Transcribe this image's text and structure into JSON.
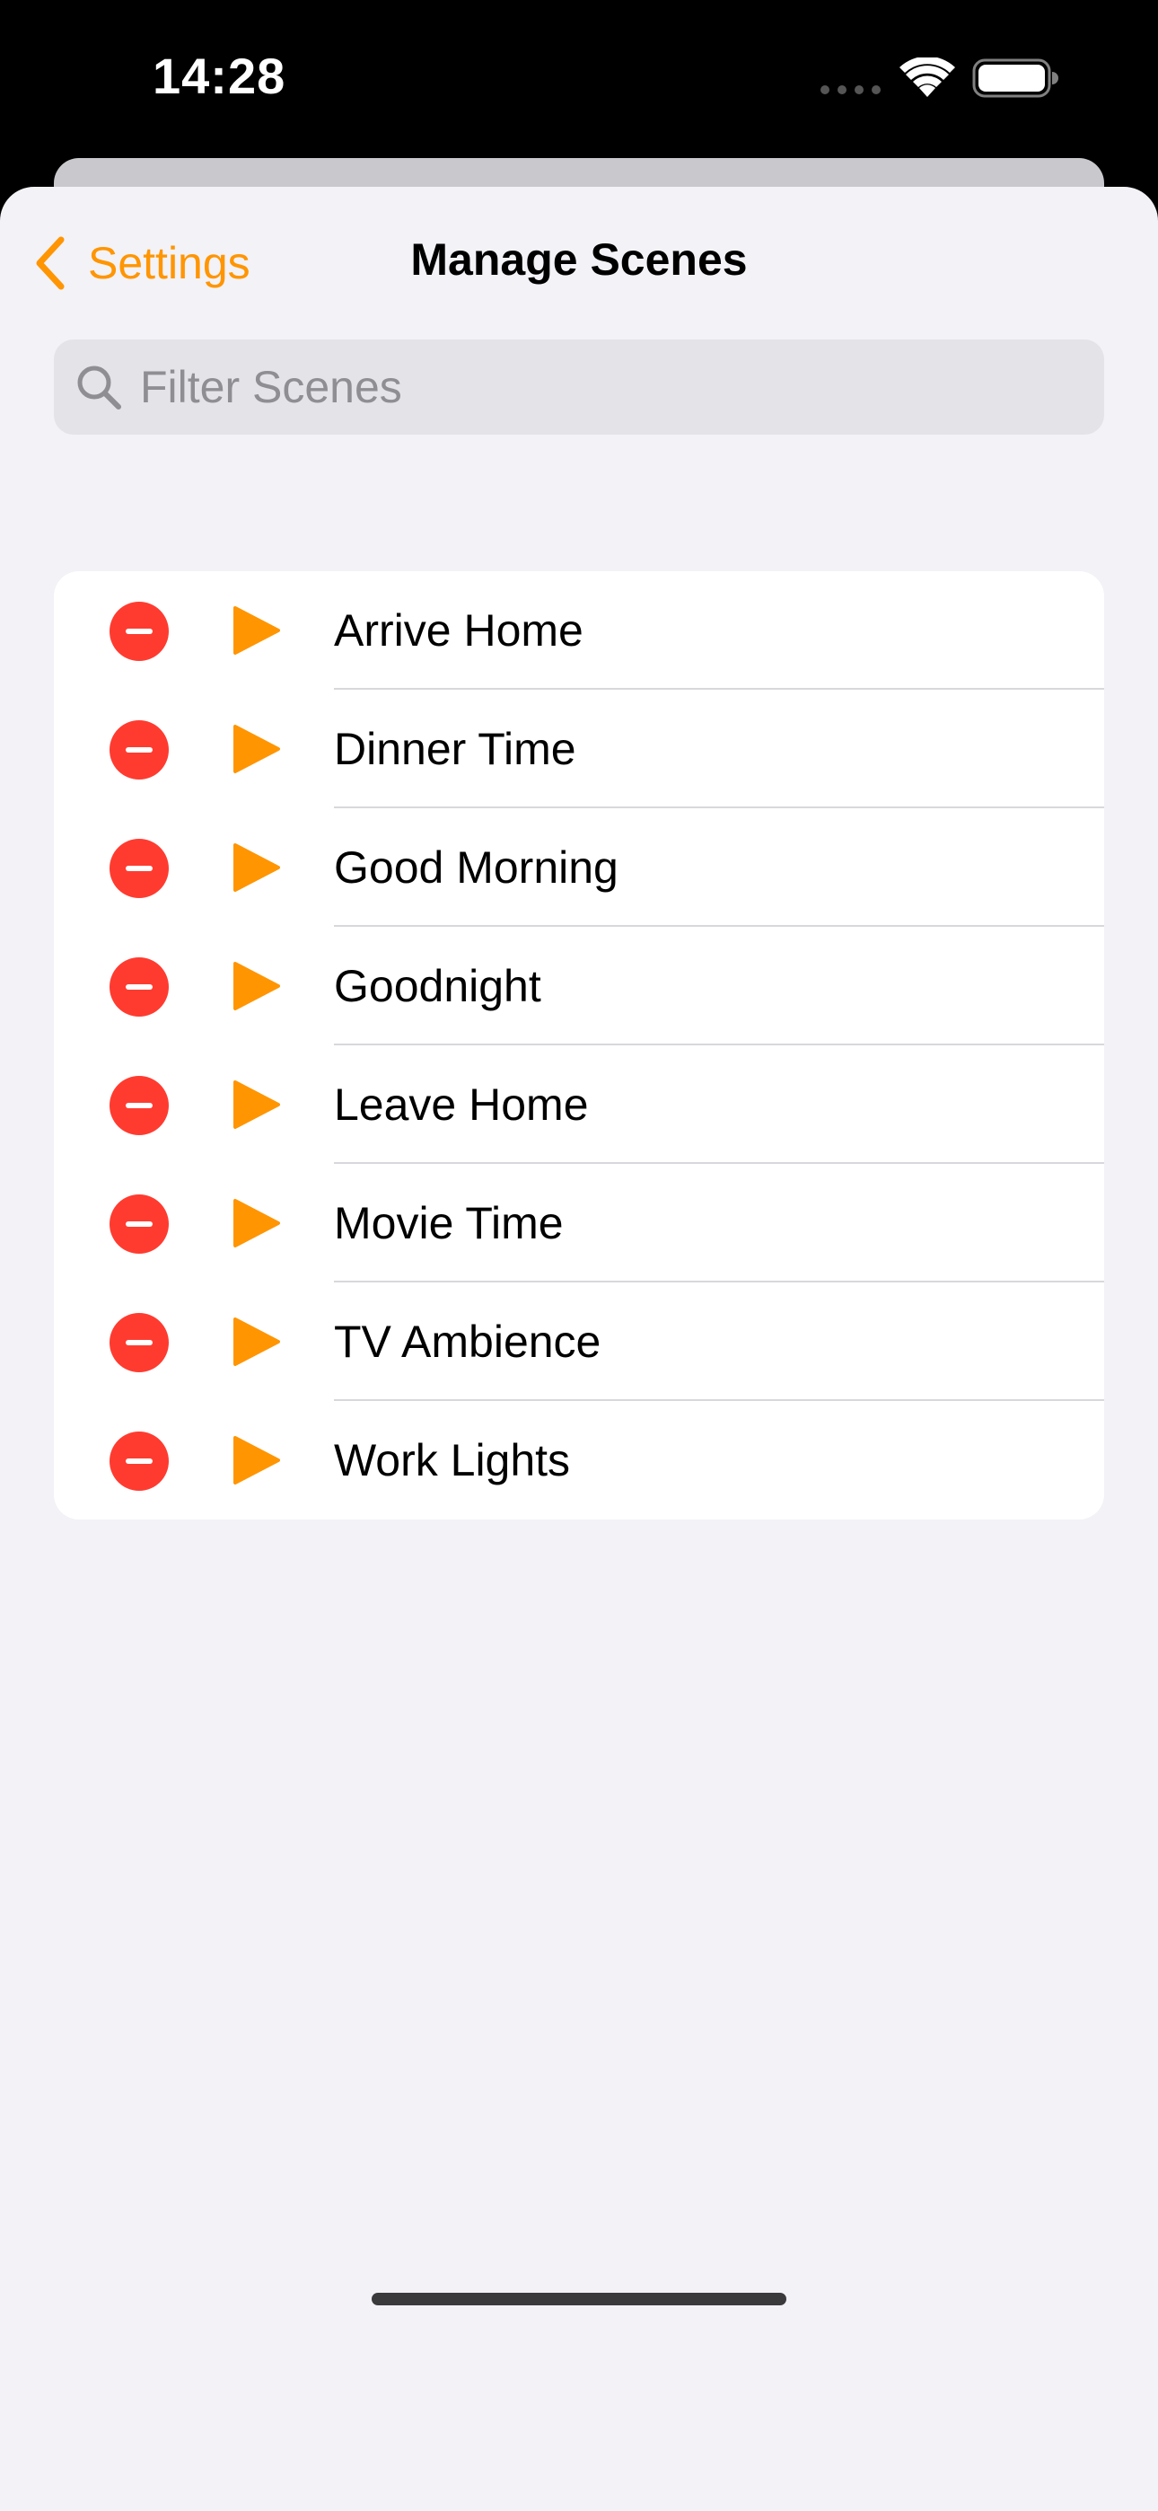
{
  "status_bar": {
    "time": "14:28",
    "icons": [
      "signal-dots-icon",
      "wifi-icon",
      "battery-icon"
    ]
  },
  "nav": {
    "back_label": "Settings",
    "title": "Manage Scenes"
  },
  "search": {
    "placeholder": "Filter Scenes",
    "value": ""
  },
  "scenes": [
    {
      "label": "Arrive Home"
    },
    {
      "label": "Dinner Time"
    },
    {
      "label": "Good Morning"
    },
    {
      "label": "Goodnight"
    },
    {
      "label": "Leave Home"
    },
    {
      "label": "Movie Time"
    },
    {
      "label": "TV Ambience"
    },
    {
      "label": "Work Lights"
    }
  ],
  "colors": {
    "accent": "#ff9500",
    "delete": "#ff3b30",
    "background": "#f2f2f7",
    "search_field": "#e3e3e8"
  }
}
